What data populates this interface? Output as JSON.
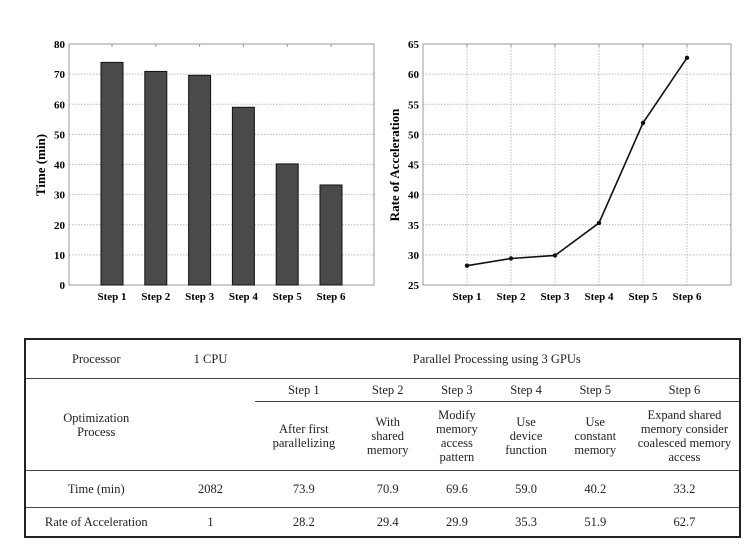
{
  "chart_data": [
    {
      "type": "bar",
      "title": "",
      "xlabel": "",
      "ylabel": "Time (min)",
      "categories": [
        "Step 1",
        "Step 2",
        "Step 3",
        "Step 4",
        "Step 5",
        "Step 6"
      ],
      "values": [
        73.9,
        70.9,
        69.6,
        59.0,
        40.2,
        33.2
      ],
      "ylim": [
        0,
        80
      ],
      "yticks": [
        0,
        10,
        20,
        30,
        40,
        50,
        60,
        70,
        80
      ],
      "grid": "horizontal dotted",
      "bar_color": "#4a4a4a"
    },
    {
      "type": "line",
      "title": "",
      "xlabel": "",
      "ylabel": "Rate of Acceleration",
      "categories": [
        "Step 1",
        "Step 2",
        "Step 3",
        "Step 4",
        "Step 5",
        "Step 6"
      ],
      "values": [
        28.2,
        29.4,
        29.9,
        35.3,
        51.9,
        62.7
      ],
      "ylim": [
        25,
        65
      ],
      "yticks": [
        25,
        30,
        35,
        40,
        45,
        50,
        55,
        60,
        65
      ],
      "grid": "both dotted",
      "line_color": "#111111"
    }
  ],
  "table": {
    "processor_label": "Processor",
    "cpu_label": "1 CPU",
    "gpu_label": "Parallel Processing using 3 GPUs",
    "optimization_label": "Optimization Process",
    "steps": [
      "Step 1",
      "Step 2",
      "Step 3",
      "Step 4",
      "Step 5",
      "Step 6"
    ],
    "step_desc": [
      "After first parallelizing",
      "With shared memory",
      "Modify memory access pattern",
      "Use device function",
      "Use constant memory",
      "Expand shared memory consider coalesced memory access"
    ],
    "rows": [
      {
        "label": "Time (min)",
        "cpu": "2082",
        "values": [
          "73.9",
          "70.9",
          "69.6",
          "59.0",
          "40.2",
          "33.2"
        ]
      },
      {
        "label": "Rate of Acceleration",
        "cpu": "1",
        "values": [
          "28.2",
          "29.4",
          "29.9",
          "35.3",
          "51.9",
          "62.7"
        ]
      }
    ]
  }
}
